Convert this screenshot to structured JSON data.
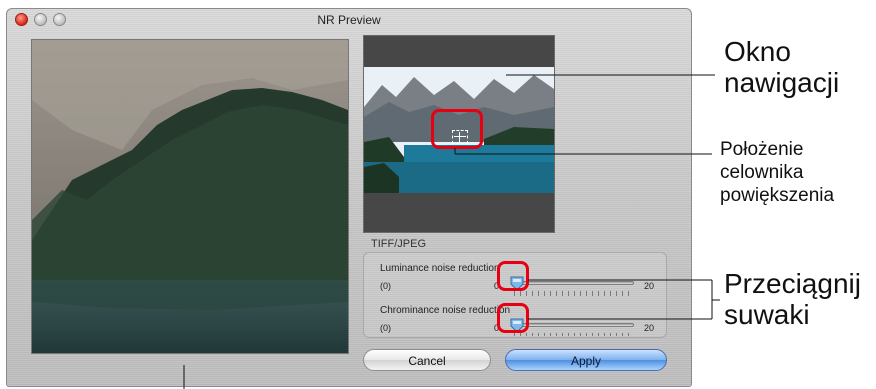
{
  "window": {
    "title": "NR Preview"
  },
  "noise_reduction": {
    "group_label": "TIFF/JPEG",
    "luminance": {
      "label": "Luminance noise reduction",
      "min": "(0)",
      "value": "0",
      "max": "20"
    },
    "chrominance": {
      "label": "Chrominance noise reduction",
      "min": "(0)",
      "value": "0",
      "max": "20"
    }
  },
  "buttons": {
    "cancel": "Cancel",
    "apply": "Apply"
  },
  "annotations": {
    "nav_window_line1": "Okno",
    "nav_window_line2": "nawigacji",
    "zoom_pos_line1": "Położenie",
    "zoom_pos_line2": "celownika",
    "zoom_pos_line3": "powiększenia",
    "drag_line1": "Przeciągnij",
    "drag_line2": "suwaki"
  },
  "colors": {
    "callout": "#e60012",
    "apply_button": "#5d9be6"
  },
  "icons": {
    "zoom_crosshair": "crosshair-icon",
    "slider_thumb": "slider-thumb-icon"
  }
}
